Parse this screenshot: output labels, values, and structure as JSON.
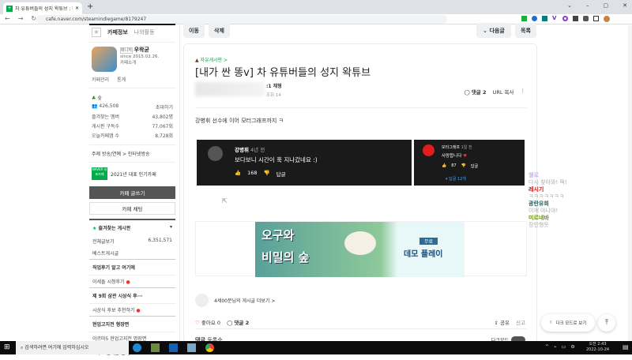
{
  "browser": {
    "tab_title": "차 유튜버들의 성지 왁튜브 : 네이",
    "new_tab": "+",
    "url": "cafe.naver.com/steamindiegame/8179247",
    "window_controls": [
      "⌄",
      "–",
      "▢",
      "✕"
    ]
  },
  "sidebar": {
    "tabs": [
      "카페정보",
      "나의활동"
    ],
    "manager_badge": "매니저",
    "manager_name": "우왁굳",
    "since": "since 2015.02.26.",
    "cafe_intro": "카페소개",
    "admin_links": [
      "카페관리",
      "통계"
    ],
    "level": "숲",
    "members": "426,508",
    "invite": "초대하기",
    "stats": [
      {
        "label": "즐겨찾는 멤버",
        "value": "43,802명"
      },
      {
        "label": "게시판 구독수",
        "value": "77,067회"
      },
      {
        "label": "오늘카페앱 수",
        "value": "8,728회"
      }
    ],
    "topic": "주제 방송/연예 > 인터넷방송",
    "naver_badge": "NAVER 대표카페",
    "award": "2021년 대표 인기카페",
    "write_button": "카페 글쓰기",
    "chat_button": "카페 채팅",
    "fav_boards_title": "즐겨찾는 게시판",
    "boards": [
      {
        "label": "전체글보기",
        "count": "6,351,571"
      },
      {
        "label": "베스트게시글"
      }
    ],
    "sections": [
      {
        "title": "직업후기 알고 여기에",
        "items": [
          "이세돌 시청후기"
        ]
      },
      {
        "title": "제 9회 삼관 시상식 후···",
        "items": [
          "시상식 후보 추천하기"
        ]
      },
      {
        "title": "현업고지전 형장면",
        "items": [
          "이르마5 현업고지전 명장면"
        ]
      },
      {
        "title": "2차 고멤티콘 할때"
      }
    ]
  },
  "toolbar": {
    "move": "이동",
    "delete": "삭제",
    "next": "다음글",
    "list": "목록"
  },
  "article": {
    "board": "자유게시판 >",
    "title": "[내가 싼 똥v] 차 유튜버들의 성지 왁튜브",
    "author_level": ":1 채형",
    "views": "조회 14",
    "comments": "댓글 2",
    "url_copy": "URL 복사",
    "body": "강병휘 선수에 이어 모터그래프까지 ㅋ",
    "yt1": {
      "name": "강병휘",
      "time": "4년 전",
      "text": "보다보니 시간이 훅 지나갔네요 :)",
      "likes": "168",
      "reply": "답글"
    },
    "yt2": {
      "name": "모터그래프",
      "time": "1일 전",
      "text": "사랑합니다",
      "likes": "87",
      "reply": "답글",
      "replies": "답글 12개"
    },
    "ad": {
      "title1": "오구와",
      "title2": "비밀의 숲",
      "free": "무료",
      "demo": "데모 플레이"
    },
    "author_more": "4세00분님의 게시글 더보기 >",
    "like": "좋아요 0",
    "comment_count": "댓글 2",
    "share": "공유",
    "report": "신고",
    "comment_header": "댓글",
    "sort": "등록순",
    "dark_toggle": "다크모드"
  },
  "chat": [
    {
      "name": "첼로",
      "text": "다시 찾아와! 떡!",
      "color": "#c9b8e0"
    },
    {
      "name": "레시기",
      "text": "ㅋㅋㅋㅋㅋㅋㅋ",
      "color": "#d01010"
    },
    {
      "name": "광란유희",
      "text": "이게 아니야!",
      "color": "#2e5e5e"
    },
    {
      "name": "미르네바",
      "text": "장인형듯",
      "color": "#6a8c10"
    }
  ],
  "float": {
    "dark_mode": "다크 모드로 보기",
    "top": "⤒"
  },
  "taskbar": {
    "search": "검색하려면 여기에 입력하십시오",
    "time": "오전 2:43",
    "date": "2022-10-24"
  }
}
